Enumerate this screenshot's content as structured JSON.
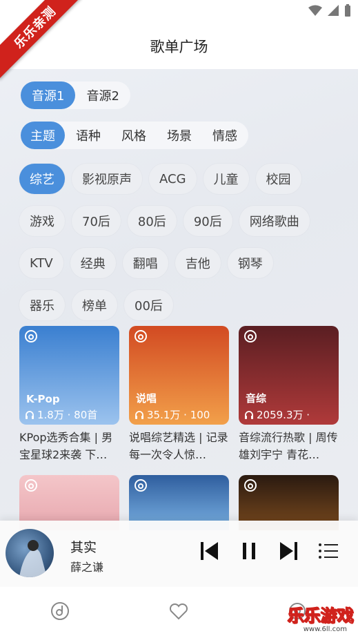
{
  "watermark_ribbon": "乐乐亲测",
  "header": {
    "title": "歌单广场"
  },
  "sources": [
    {
      "label": "音源1",
      "active": true
    },
    {
      "label": "音源2",
      "active": false
    }
  ],
  "categories": [
    {
      "label": "主题",
      "active": true
    },
    {
      "label": "语种",
      "active": false
    },
    {
      "label": "风格",
      "active": false
    },
    {
      "label": "场景",
      "active": false
    },
    {
      "label": "情感",
      "active": false
    }
  ],
  "tags": [
    [
      "综艺",
      "影视原声",
      "ACG",
      "儿童",
      "校园"
    ],
    [
      "游戏",
      "70后",
      "80后",
      "90后",
      "网络歌曲"
    ],
    [
      "KTV",
      "经典",
      "翻唱",
      "吉他",
      "钢琴"
    ],
    [
      "器乐",
      "榜单",
      "00后"
    ]
  ],
  "active_tag": "综艺",
  "playlists": [
    {
      "badge": "K-Pop",
      "meta": "1.8万 · 80首",
      "name": "KPop选秀合集 | 男宝星球2来袭 下…",
      "color_a": "#3a7fd0",
      "color_b": "#9cc3ee"
    },
    {
      "badge": "说唱",
      "meta": "35.1万 · 100",
      "name": "说唱综艺精选 | 记录每一次令人惊…",
      "color_a": "#d24a22",
      "color_b": "#f2a04a"
    },
    {
      "badge": "音综",
      "meta": "2059.3万 ·",
      "name": "音综流行热歌 | 周传雄刘宇宁 青花…",
      "color_a": "#5a1e22",
      "color_b": "#b03a3a"
    }
  ],
  "playlists_row2": [
    {
      "color_a": "#f4c6c9",
      "color_b": "#e7a7ae"
    },
    {
      "color_a": "#2f5e9e",
      "color_b": "#7bb2e4"
    },
    {
      "color_a": "#2a1a10",
      "color_b": "#7a4a1e"
    }
  ],
  "player": {
    "song": "其实",
    "artist": "薛之谦"
  },
  "nav": [
    "music-disc-icon",
    "heart-icon",
    "settings-icon"
  ],
  "site_watermark": {
    "text": "乐乐游戏",
    "url": "www.6ll.com"
  },
  "colors": {
    "accent": "#4a8fdc",
    "ribbon": "#d0221c"
  }
}
